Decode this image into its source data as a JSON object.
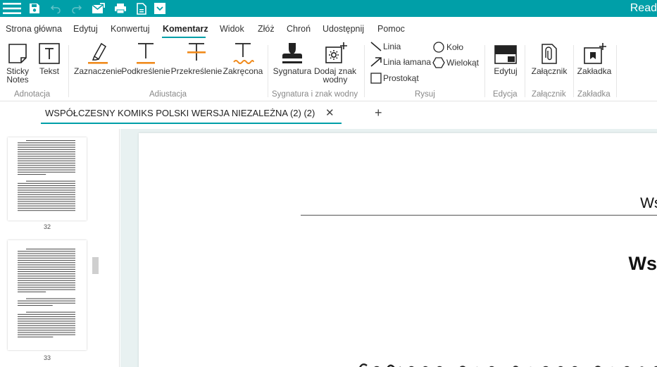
{
  "app": {
    "title": "Read"
  },
  "menu": {
    "tabs": [
      "Strona główna",
      "Edytuj",
      "Konwertuj",
      "Komentarz",
      "Widok",
      "Złóż",
      "Chroń",
      "Udostępnij",
      "Pomoc"
    ],
    "active_tab": "Komentarz"
  },
  "ribbon": {
    "adnotacja": {
      "sticky_notes": "Sticky Notes",
      "tekst": "Tekst",
      "group": "Adnotacja"
    },
    "adiustacja": {
      "zaznaczenie": "Zaznaczenie",
      "podkreslenie": "Podkreślenie",
      "przekreslenie": "Przekreślenie",
      "zakrecona": "Zakręcona",
      "group": "Adiustacja",
      "colors": {
        "highlight": "#f08a1c",
        "squiggle": "#f08a1c"
      }
    },
    "sygnatura": {
      "sygnatura": "Sygnatura",
      "znak_wodny": "Dodaj znak wodny",
      "group": "Sygnatura i znak wodny"
    },
    "rysuj": {
      "linia": "Linia",
      "kolo": "Koło",
      "linia_lamana": "Linia łamana",
      "wielokat": "Wielokąt",
      "prostokat": "Prostokąt",
      "group": "Rysuj"
    },
    "edycja": {
      "edytuj": "Edytuj",
      "group": "Edycja"
    },
    "zalacznik": {
      "zalacznik": "Załącznik",
      "group": "Załącznik"
    },
    "zakladka": {
      "zakladka": "Zakładka",
      "group": "Zakładka"
    }
  },
  "document_tab": {
    "title": "WSPÓŁCZESNY KOMIKS POLSKI WERSJA NIEZALEŻNA (2) (2)",
    "close": "✕",
    "add": "+"
  },
  "thumbnails": [
    {
      "page": "32"
    },
    {
      "page": "33"
    }
  ],
  "page": {
    "header": "Wstę",
    "heading": "Wstę"
  },
  "colors": {
    "accent": "#009fa8",
    "view_bg": "#e8f1f1"
  }
}
